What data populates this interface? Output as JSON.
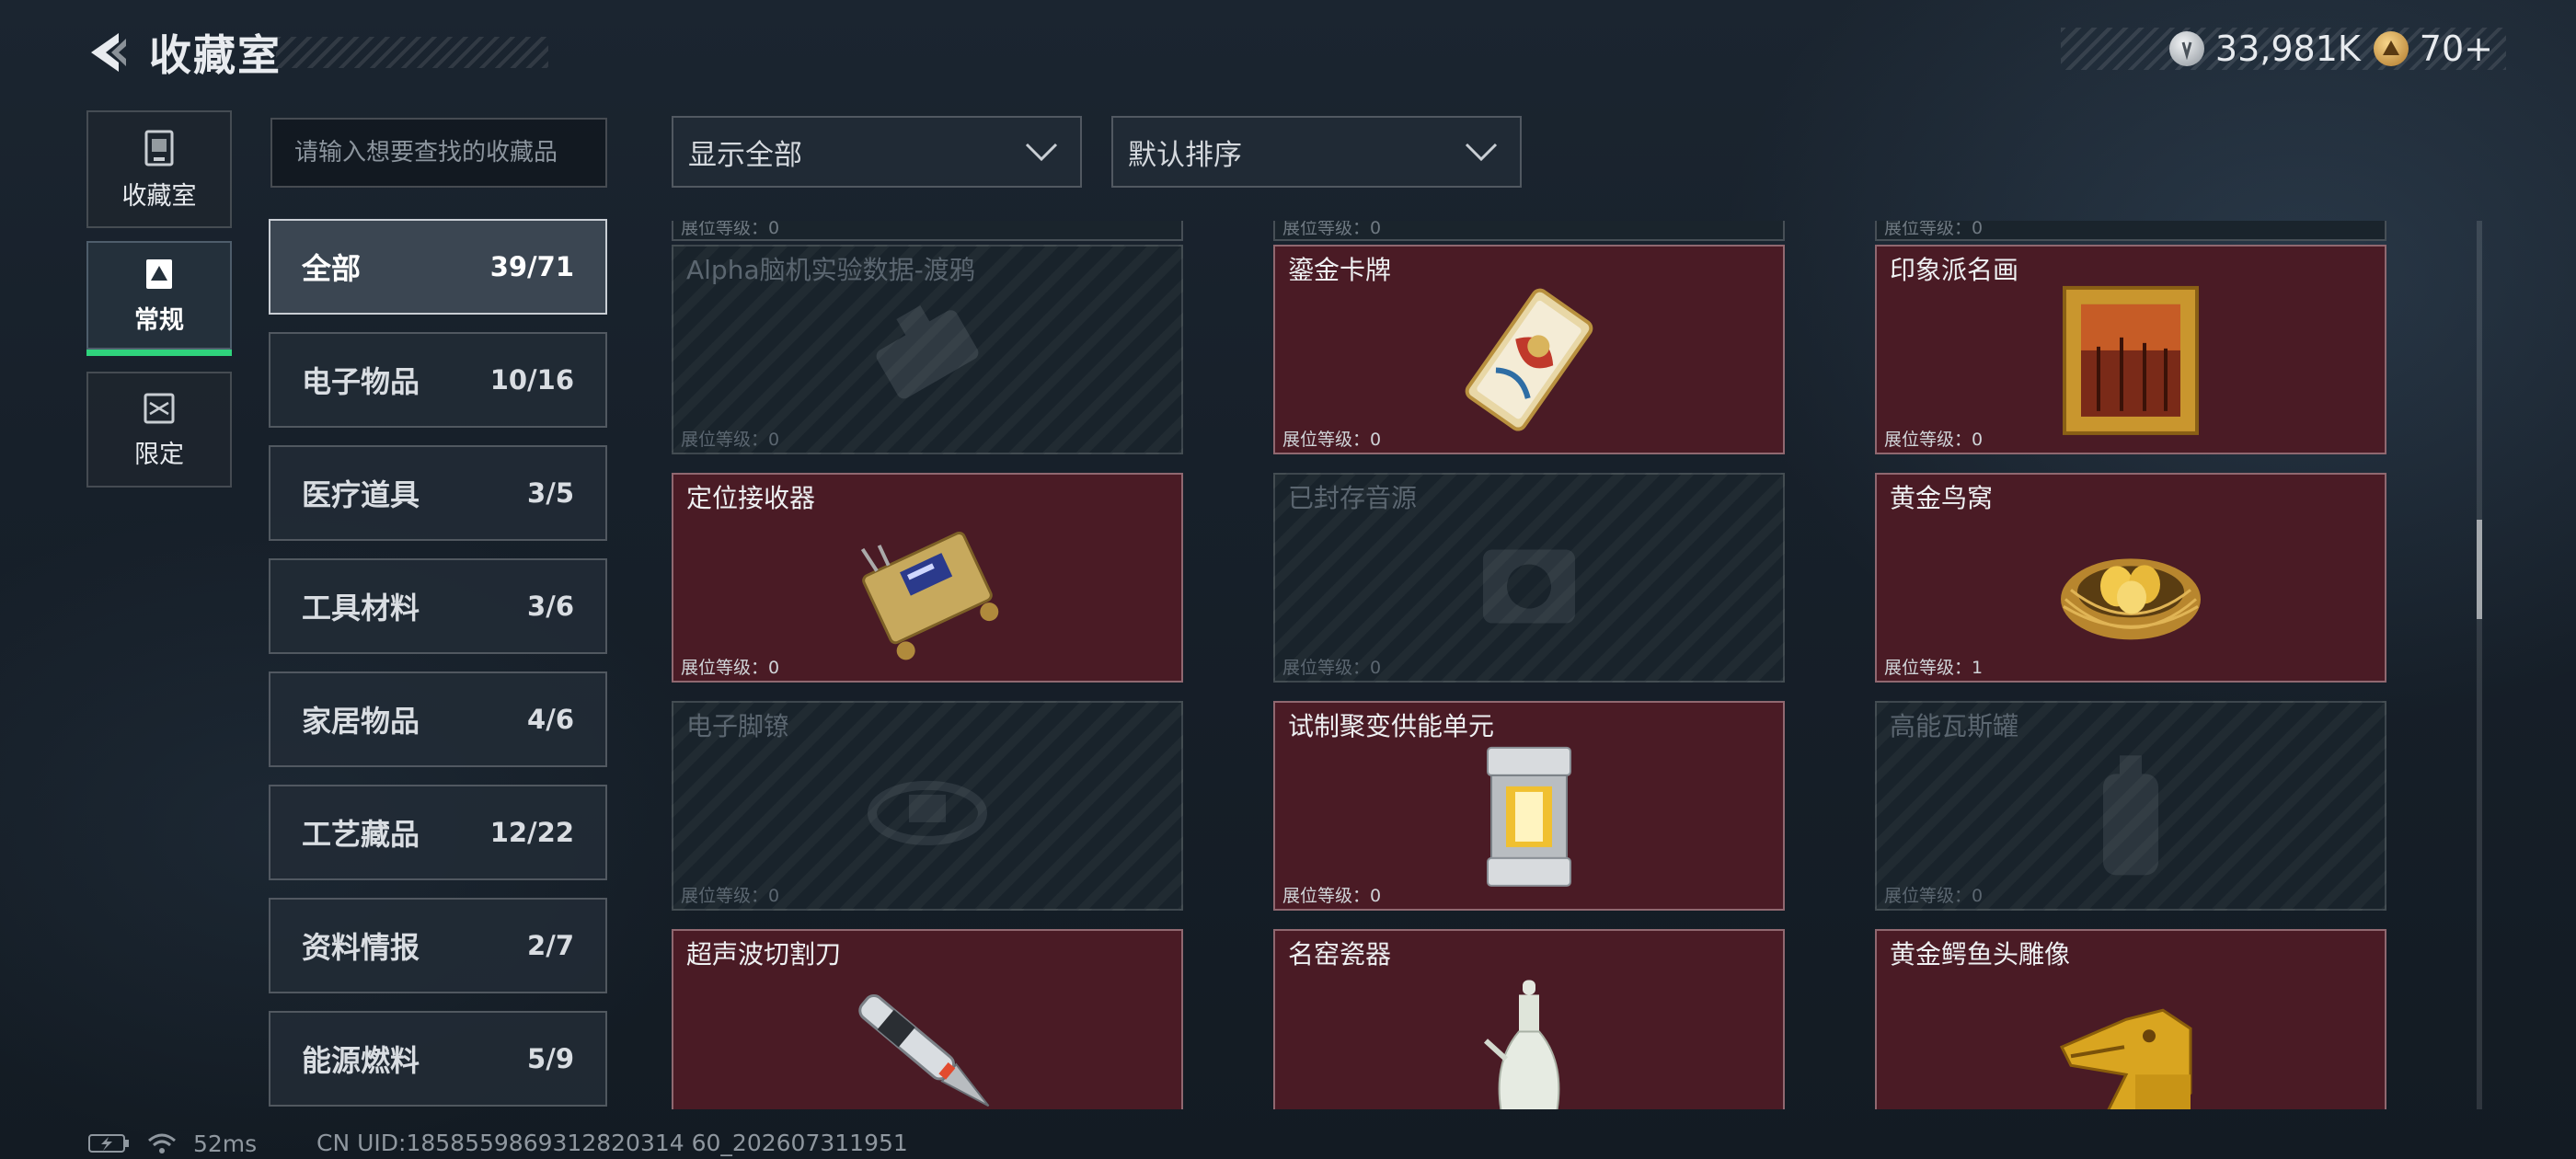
{
  "header": {
    "title": "收藏室"
  },
  "currency": [
    {
      "icon": "silver-coin-icon",
      "value": "33,981K"
    },
    {
      "icon": "gold-coin-icon",
      "value": "70+"
    }
  ],
  "left_nav": [
    {
      "icon": "collection-room-icon",
      "label": "收藏室",
      "active": false
    },
    {
      "icon": "regular-card-icon",
      "label": "常规",
      "active": true
    },
    {
      "icon": "limited-card-icon",
      "label": "限定",
      "active": false
    }
  ],
  "search": {
    "placeholder": "请输入想要查找的收藏品"
  },
  "categories": [
    {
      "name": "全部",
      "count": "39/71",
      "active": true
    },
    {
      "name": "电子物品",
      "count": "10/16"
    },
    {
      "name": "医疗道具",
      "count": "3/5"
    },
    {
      "name": "工具材料",
      "count": "3/6"
    },
    {
      "name": "家居物品",
      "count": "4/6"
    },
    {
      "name": "工艺藏品",
      "count": "12/22"
    },
    {
      "name": "资料情报",
      "count": "2/7"
    },
    {
      "name": "能源燃料",
      "count": "5/9"
    }
  ],
  "filters": {
    "show": "显示全部",
    "sort": "默认排序"
  },
  "partial_row_label": "展位等级：0",
  "items": [
    {
      "name": "Alpha脑机实验数据-渡鸦",
      "level": "展位等级：0",
      "owned": false,
      "icon": "brain-data-drive-icon"
    },
    {
      "name": "鎏金卡牌",
      "level": "展位等级：0",
      "owned": true,
      "icon": "gilded-card-icon"
    },
    {
      "name": "印象派名画",
      "level": "展位等级：0",
      "owned": true,
      "icon": "framed-painting-icon"
    },
    {
      "name": "定位接收器",
      "level": "展位等级：0",
      "owned": true,
      "icon": "gps-receiver-icon"
    },
    {
      "name": "已封存音源",
      "level": "展位等级：0",
      "owned": false,
      "icon": "sealed-audio-icon"
    },
    {
      "name": "黄金鸟窝",
      "level": "展位等级：1",
      "owned": true,
      "icon": "golden-nest-icon"
    },
    {
      "name": "电子脚镣",
      "level": "展位等级：0",
      "owned": false,
      "icon": "electronic-anklet-icon"
    },
    {
      "name": "试制聚变供能单元",
      "level": "展位等级：0",
      "owned": true,
      "icon": "fusion-cell-icon"
    },
    {
      "name": "高能瓦斯罐",
      "level": "展位等级：0",
      "owned": false,
      "icon": "gas-canister-icon"
    },
    {
      "name": "超声波切割刀",
      "level": "",
      "owned": true,
      "icon": "ultrasonic-cutter-icon"
    },
    {
      "name": "名窑瓷器",
      "level": "",
      "owned": true,
      "icon": "porcelain-vase-icon"
    },
    {
      "name": "黄金鳄鱼头雕像",
      "level": "",
      "owned": true,
      "icon": "golden-crocodile-head-icon"
    }
  ],
  "status_bar": {
    "ping": "52ms",
    "uid": "CN UID:1858559869312820314 60_202607311951"
  }
}
